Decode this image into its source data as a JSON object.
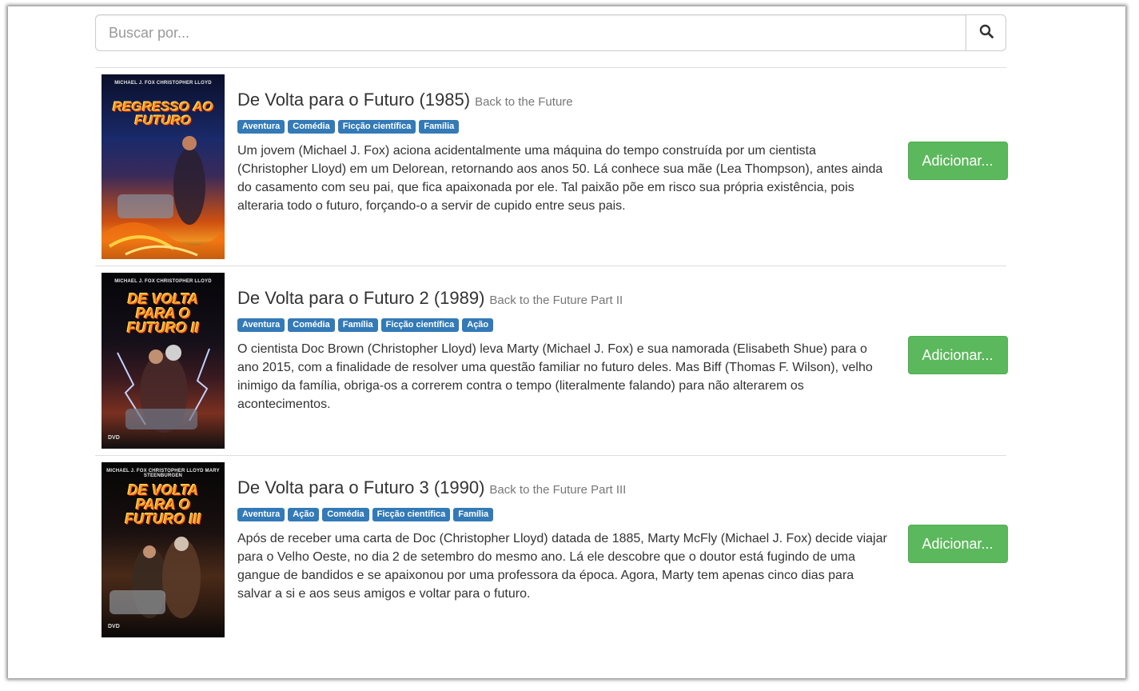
{
  "search": {
    "placeholder": "Buscar por...",
    "button_icon": "search-icon"
  },
  "movies": [
    {
      "title": "De Volta para o Futuro (1985)",
      "original_title": "Back to the Future",
      "genres": [
        "Aventura",
        "Comédia",
        "Ficção científica",
        "Família"
      ],
      "synopsis": "Um jovem (Michael J. Fox) aciona acidentalmente uma máquina do tempo construída por um cientista (Christopher Lloyd) em um Delorean, retornando aos anos 50. Lá conhece sua mãe (Lea Thompson), antes ainda do casamento com seu pai, que fica apaixonada por ele. Tal paixão põe em risco sua própria existência, pois alteraria todo o futuro, forçando-o a servir de cupido entre seus pais.",
      "button_label": "Adicionar...",
      "poster_credits": "MICHAEL J. FOX   CHRISTOPHER LLOYD",
      "poster_logo": "REGRESSO AO FUTURO"
    },
    {
      "title": "De Volta para o Futuro 2 (1989)",
      "original_title": "Back to the Future Part II",
      "genres": [
        "Aventura",
        "Comédia",
        "Família",
        "Ficção científica",
        "Ação"
      ],
      "synopsis": "O cientista Doc Brown (Christopher Lloyd) leva Marty (Michael J. Fox) e sua namorada (Elisabeth Shue) para o ano 2015, com a finalidade de resolver uma questão familiar no futuro deles. Mas Biff (Thomas F. Wilson), velho inimigo da família, obriga-os a correrem contra o tempo (literalmente falando) para não alterarem os acontecimentos.",
      "button_label": "Adicionar...",
      "poster_credits": "MICHAEL J. FOX   CHRISTOPHER LLOYD",
      "poster_logo": "DE VOLTA PARA O FUTURO II",
      "poster_badge": "DVD"
    },
    {
      "title": "De Volta para o Futuro 3 (1990)",
      "original_title": "Back to the Future Part III",
      "genres": [
        "Aventura",
        "Ação",
        "Comédia",
        "Ficção científica",
        "Família"
      ],
      "synopsis": "Após de receber uma carta de Doc (Christopher Lloyd) datada de 1885, Marty McFly (Michael J. Fox) decide viajar para o Velho Oeste, no dia 2 de setembro do mesmo ano. Lá ele descobre que o doutor está fugindo de uma gangue de bandidos e se apaixonou por uma professora da época. Agora, Marty tem apenas cinco dias para salvar a si e aos seus amigos e voltar para o futuro.",
      "button_label": "Adicionar...",
      "poster_credits": "MICHAEL J. FOX   CHRISTOPHER LLOYD   MARY STEENBURGEN",
      "poster_logo": "DE VOLTA PARA O FUTURO III",
      "poster_badge": "DVD"
    }
  ],
  "colors": {
    "tag": "#337ab7",
    "add_button": "#5cb85c"
  }
}
